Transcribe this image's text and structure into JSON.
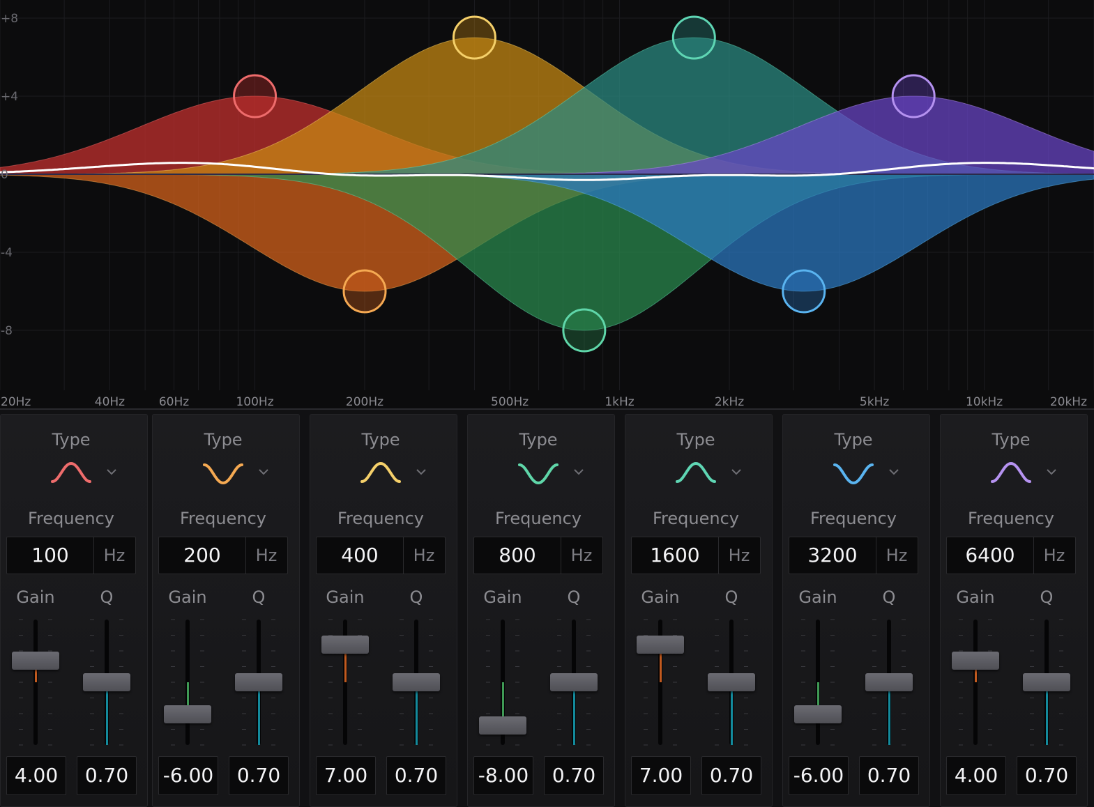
{
  "graph": {
    "y_axis_labels": [
      "+8",
      "+4",
      "0",
      "-4",
      "-8"
    ],
    "x_axis_labels": [
      "20Hz",
      "40Hz",
      "60Hz",
      "100Hz",
      "200Hz",
      "500Hz",
      "1kHz",
      "2kHz",
      "5kHz",
      "10kHz",
      "20kHz"
    ],
    "x_axis_values_hz": [
      20,
      40,
      60,
      100,
      200,
      500,
      1000,
      2000,
      5000,
      10000,
      20000
    ],
    "y_axis_values_db": [
      8,
      4,
      0,
      -4,
      -8
    ]
  },
  "bands": [
    {
      "type_label": "Type",
      "type": "peak",
      "color": "#ee6c6c",
      "fill": "#c8312f",
      "frequency_label": "Frequency",
      "frequency": "100",
      "unit": "Hz",
      "gain_label": "Gain",
      "q_label": "Q",
      "gain": "4.00",
      "q": "0.70",
      "gain_db": 4,
      "q_value": 0.7
    },
    {
      "type_label": "Type",
      "type": "notch",
      "color": "#f5a952",
      "fill": "#d9641c",
      "frequency_label": "Frequency",
      "frequency": "200",
      "unit": "Hz",
      "gain_label": "Gain",
      "q_label": "Q",
      "gain": "-6.00",
      "q": "0.70",
      "gain_db": -6,
      "q_value": 0.7
    },
    {
      "type_label": "Type",
      "type": "peak",
      "color": "#f5d06a",
      "fill": "#c98a14",
      "frequency_label": "Frequency",
      "frequency": "400",
      "unit": "Hz",
      "gain_label": "Gain",
      "q_label": "Q",
      "gain": "7.00",
      "q": "0.70",
      "gain_db": 7,
      "q_value": 0.7
    },
    {
      "type_label": "Type",
      "type": "notch",
      "color": "#5fd6a9",
      "fill": "#2a8a4f",
      "frequency_label": "Frequency",
      "frequency": "800",
      "unit": "Hz",
      "gain_label": "Gain",
      "q_label": "Q",
      "gain": "-8.00",
      "q": "0.70",
      "gain_db": -8,
      "q_value": 0.7
    },
    {
      "type_label": "Type",
      "type": "peak",
      "color": "#5fd6b4",
      "fill": "#2b8c84",
      "frequency_label": "Frequency",
      "frequency": "1600",
      "unit": "Hz",
      "gain_label": "Gain",
      "q_label": "Q",
      "gain": "7.00",
      "q": "0.70",
      "gain_db": 7,
      "q_value": 0.7
    },
    {
      "type_label": "Type",
      "type": "notch",
      "color": "#5ab4f0",
      "fill": "#2b78c2",
      "frequency_label": "Frequency",
      "frequency": "3200",
      "unit": "Hz",
      "gain_label": "Gain",
      "q_label": "Q",
      "gain": "-6.00",
      "q": "0.70",
      "gain_db": -6,
      "q_value": 0.7
    },
    {
      "type_label": "Type",
      "type": "peak",
      "color": "#b592f0",
      "fill": "#6a45c8",
      "frequency_label": "Frequency",
      "frequency": "6400",
      "unit": "Hz",
      "gain_label": "Gain",
      "q_label": "Q",
      "gain": "4.00",
      "q": "0.70",
      "gain_db": 4,
      "q_value": 0.7
    }
  ],
  "colors": {
    "background": "#111113",
    "graph_background": "#0c0c0d",
    "response_curve": "#ffffff",
    "gain_fill_positive": "#c25a1f",
    "gain_fill_negative": "#3f9a55",
    "q_fill": "#138a9c"
  },
  "icons": {
    "peak": "peak-shape-icon",
    "notch": "notch-shape-icon",
    "dropdown": "chevron-down-icon"
  }
}
